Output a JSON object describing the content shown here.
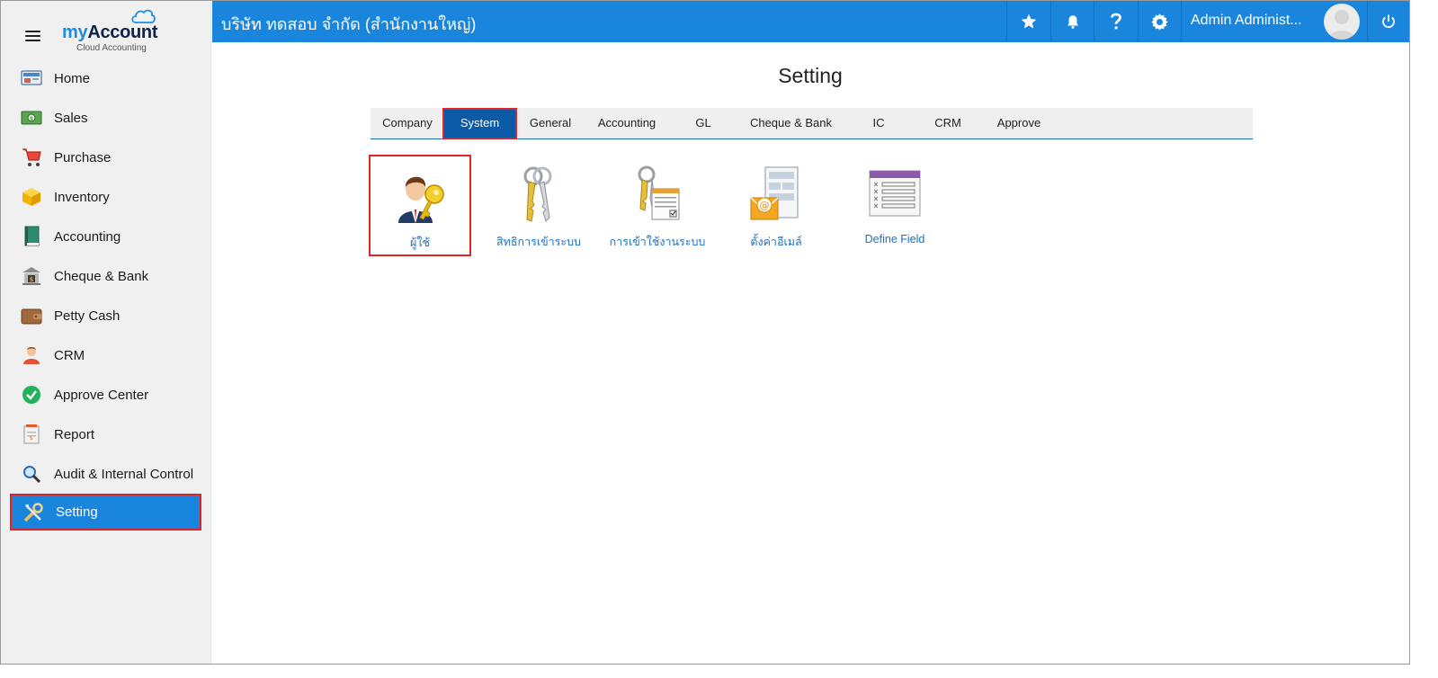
{
  "brand": {
    "name_part1": "my",
    "name_part2": "Account",
    "tagline": "Cloud Accounting"
  },
  "sidebar": {
    "items": [
      {
        "label": "Home",
        "icon": "home-icon"
      },
      {
        "label": "Sales",
        "icon": "sales-money-icon"
      },
      {
        "label": "Purchase",
        "icon": "shopping-cart-icon"
      },
      {
        "label": "Inventory",
        "icon": "box-icon"
      },
      {
        "label": "Accounting",
        "icon": "ledger-book-icon"
      },
      {
        "label": "Cheque & Bank",
        "icon": "bank-icon"
      },
      {
        "label": "Petty Cash",
        "icon": "wallet-icon"
      },
      {
        "label": "CRM",
        "icon": "person-icon"
      },
      {
        "label": "Approve Center",
        "icon": "check-circle-icon"
      },
      {
        "label": "Report",
        "icon": "report-icon"
      },
      {
        "label": "Audit & Internal Control",
        "icon": "magnifier-icon"
      },
      {
        "label": "Setting",
        "icon": "tools-icon",
        "active": true
      }
    ]
  },
  "header": {
    "company": "บริษัท ทดสอบ จำกัด (สำนักงานใหญ่)",
    "user_name": "Admin Administ...",
    "icons": [
      "star-icon",
      "bell-icon",
      "help-icon",
      "gear-icon",
      "power-icon"
    ]
  },
  "main": {
    "title": "Setting",
    "tabs": [
      {
        "label": "Company"
      },
      {
        "label": "System",
        "active": true
      },
      {
        "label": "General"
      },
      {
        "label": "Accounting"
      },
      {
        "label": "GL"
      },
      {
        "label": "Cheque & Bank"
      },
      {
        "label": "IC"
      },
      {
        "label": "CRM"
      },
      {
        "label": "Approve"
      }
    ],
    "tiles": [
      {
        "label": "ผู้ใช้",
        "icon": "user-key-icon",
        "active": true
      },
      {
        "label": "สิทธิการเข้าระบบ",
        "icon": "keys-icon"
      },
      {
        "label": "การเข้าใช้งานระบบ",
        "icon": "key-document-icon"
      },
      {
        "label": "ตั้งค่าอีเมล์",
        "icon": "email-setting-icon"
      },
      {
        "label": "Define Field",
        "icon": "define-field-icon"
      }
    ]
  },
  "colors": {
    "primary": "#1a85dc",
    "highlight": "#e0242a",
    "tab_active": "#0b5aa5",
    "link": "#1f6fbf"
  }
}
